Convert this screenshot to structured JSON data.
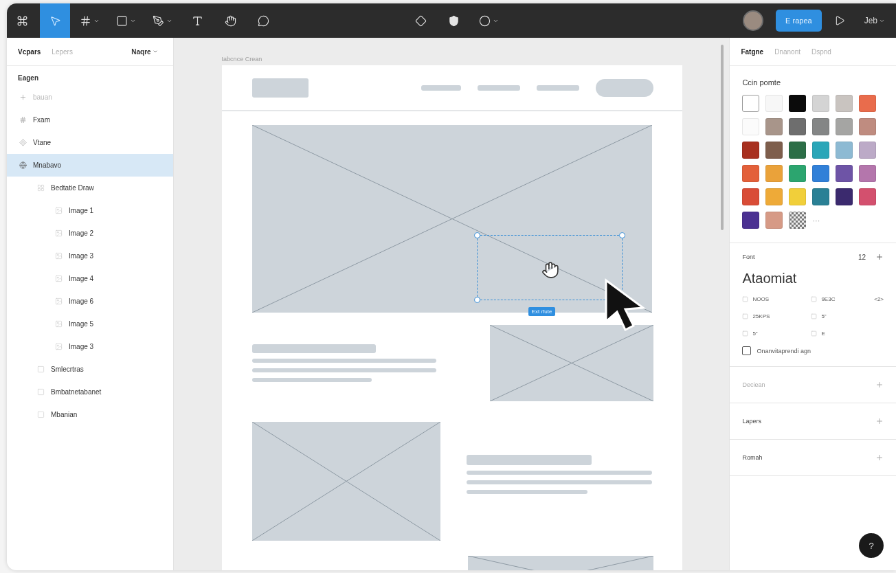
{
  "toolbar": {
    "left_tools": [
      {
        "kind": "logo",
        "selected": false
      },
      {
        "kind": "move",
        "selected": true
      },
      {
        "kind": "frame",
        "selected": false,
        "caret": true
      },
      {
        "kind": "shape",
        "selected": false,
        "caret": true
      },
      {
        "kind": "pen",
        "selected": false,
        "caret": true
      },
      {
        "kind": "text",
        "selected": false
      },
      {
        "kind": "hand",
        "selected": false
      },
      {
        "kind": "comment",
        "selected": false
      }
    ],
    "center_tools": [
      {
        "kind": "component",
        "caret": false
      },
      {
        "kind": "fill",
        "caret": false
      },
      {
        "kind": "circle",
        "caret": true
      }
    ],
    "share_button": "E rapea",
    "zoom": "Jeb"
  },
  "left_panel": {
    "tabs": [
      {
        "label": "Vcpars",
        "selected": true
      },
      {
        "label": "Lepers",
        "selected": false
      }
    ],
    "page_menu": "Naqre",
    "section_title": "Eagen",
    "layers": [
      {
        "name": "bauan",
        "kind": "add",
        "selected": false,
        "dimmed": true
      },
      {
        "name": "Fxam",
        "kind": "frame",
        "selected": false,
        "dimmed": false
      },
      {
        "name": "Vtane",
        "kind": "component",
        "selected": false,
        "dimmed": false
      },
      {
        "name": "Mnabavo",
        "kind": "globe",
        "selected": true,
        "dimmed": false,
        "children": [
          {
            "name": "Bedtatie Draw",
            "kind": "group",
            "selected": false,
            "dimmed": false,
            "children": [
              {
                "name": "Image 1",
                "kind": "image",
                "selected": false,
                "dimmed": false
              },
              {
                "name": "Image 2",
                "kind": "image",
                "selected": false,
                "dimmed": false
              },
              {
                "name": "Image 3",
                "kind": "image",
                "selected": false,
                "dimmed": false
              },
              {
                "name": "Image 4",
                "kind": "image",
                "selected": false,
                "dimmed": false
              },
              {
                "name": "Image 6",
                "kind": "image",
                "selected": false,
                "dimmed": false
              },
              {
                "name": "Image 5",
                "kind": "image",
                "selected": false,
                "dimmed": false
              },
              {
                "name": "Image 3",
                "kind": "image",
                "selected": false,
                "dimmed": false
              }
            ]
          },
          {
            "name": "Smlecrtras",
            "kind": "rect",
            "selected": false,
            "dimmed": false
          },
          {
            "name": "Bmbatnetabanet",
            "kind": "rect",
            "selected": false,
            "dimmed": false
          },
          {
            "name": "Mbanian",
            "kind": "rect",
            "selected": false,
            "dimmed": false
          }
        ]
      }
    ]
  },
  "canvas": {
    "frame_label": "Iabcnce Crean",
    "selection_label": "Ext rfute"
  },
  "right_panel": {
    "tabs": [
      {
        "label": "Fatgne",
        "selected": true
      },
      {
        "label": "Dnanont",
        "selected": false
      },
      {
        "label": "Dspnd",
        "selected": false
      }
    ],
    "palette_title": "Ccin pomte",
    "swatches": [
      {
        "kind": "color",
        "color": "#ffffff",
        "selected": true
      },
      {
        "kind": "color",
        "color": "#f7f7f7",
        "selected": false
      },
      {
        "kind": "color",
        "color": "#0b0b0b",
        "selected": false
      },
      {
        "kind": "color",
        "color": "#d4d4d4",
        "selected": false
      },
      {
        "kind": "color",
        "color": "#c9c4c0",
        "selected": false
      },
      {
        "kind": "color",
        "color": "#e96c4c",
        "selected": false
      },
      {
        "kind": "color",
        "color": "#fbfbfb",
        "selected": false
      },
      {
        "kind": "color",
        "color": "#a8958a",
        "selected": false
      },
      {
        "kind": "color",
        "color": "#6e6e6e",
        "selected": false
      },
      {
        "kind": "color",
        "color": "#848686",
        "selected": false
      },
      {
        "kind": "color",
        "color": "#a5a5a3",
        "selected": false
      },
      {
        "kind": "color",
        "color": "#bf8c80",
        "selected": false
      },
      {
        "kind": "color",
        "color": "#a8301f",
        "selected": false
      },
      {
        "kind": "color",
        "color": "#7e5e4c",
        "selected": false
      },
      {
        "kind": "color",
        "color": "#2c6e47",
        "selected": false
      },
      {
        "kind": "color",
        "color": "#2aa6b8",
        "selected": false
      },
      {
        "kind": "color",
        "color": "#8dbad3",
        "selected": false
      },
      {
        "kind": "color",
        "color": "#bcaac7",
        "selected": false
      },
      {
        "kind": "color",
        "color": "#e3603a",
        "selected": false
      },
      {
        "kind": "color",
        "color": "#eaa23a",
        "selected": false
      },
      {
        "kind": "color",
        "color": "#2ca56f",
        "selected": false
      },
      {
        "kind": "color",
        "color": "#3180d8",
        "selected": false
      },
      {
        "kind": "color",
        "color": "#6e54a6",
        "selected": false
      },
      {
        "kind": "color",
        "color": "#b476ac",
        "selected": false
      },
      {
        "kind": "color",
        "color": "#d94c37",
        "selected": false
      },
      {
        "kind": "color",
        "color": "#eeaa38",
        "selected": false
      },
      {
        "kind": "color",
        "color": "#f1cf3a",
        "selected": false
      },
      {
        "kind": "color",
        "color": "#2a8095",
        "selected": false
      },
      {
        "kind": "color",
        "color": "#3b2a6e",
        "selected": false
      },
      {
        "kind": "color",
        "color": "#d3506e",
        "selected": false
      },
      {
        "kind": "color",
        "color": "#4b3192",
        "selected": false
      },
      {
        "kind": "color",
        "color": "#d69a86",
        "selected": false
      },
      {
        "kind": "pattern",
        "selected": false
      }
    ],
    "more_swatches": "···",
    "font": {
      "label": "Font",
      "size": "12",
      "name": "Ataomiat",
      "properties": [
        {
          "value": "NOOS"
        },
        {
          "value": "9E3C",
          "extra": "<2>"
        },
        {
          "value": "25KPS"
        },
        {
          "value": "5\""
        },
        {
          "value": "5\""
        },
        {
          "value": "E"
        }
      ],
      "checkbox": {
        "label": "Onanvitaprendi agn",
        "checked": false
      }
    },
    "sections": [
      {
        "label": "Deciean",
        "dimmed": true
      },
      {
        "label": "Lapers",
        "dimmed": false
      },
      {
        "label": "Romah",
        "dimmed": false
      }
    ],
    "help": "?"
  }
}
